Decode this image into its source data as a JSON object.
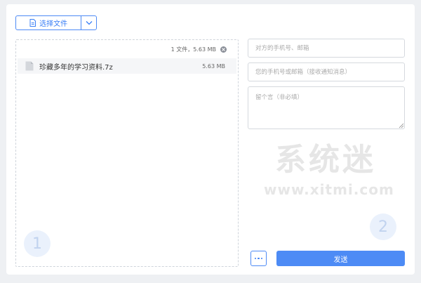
{
  "toolbar": {
    "select_files_label": "选择文件",
    "file_icon": "document-icon",
    "dropdown_icon": "chevron-down-icon"
  },
  "file_panel": {
    "summary": "1 文件，5.63 MB",
    "files": [
      {
        "name": "珍藏多年的学习资料.7z",
        "size": "5.63 MB"
      }
    ],
    "step_number": "1"
  },
  "form": {
    "recipient_placeholder": "对方的手机号、邮箱",
    "sender_placeholder": "您的手机号或邮箱（接收通知消息）",
    "message_placeholder": "留个言（非必填）",
    "step_number": "2",
    "more_icon": "more-dots-icon",
    "send_label": "发送"
  },
  "watermark": {
    "chinese": "系统迷",
    "url": "www.xitmi.com"
  },
  "colors": {
    "accent": "#4d8bf5",
    "background": "#eef0f3",
    "badge_bg": "#eaf1fc",
    "badge_text": "#c1d3ef"
  }
}
